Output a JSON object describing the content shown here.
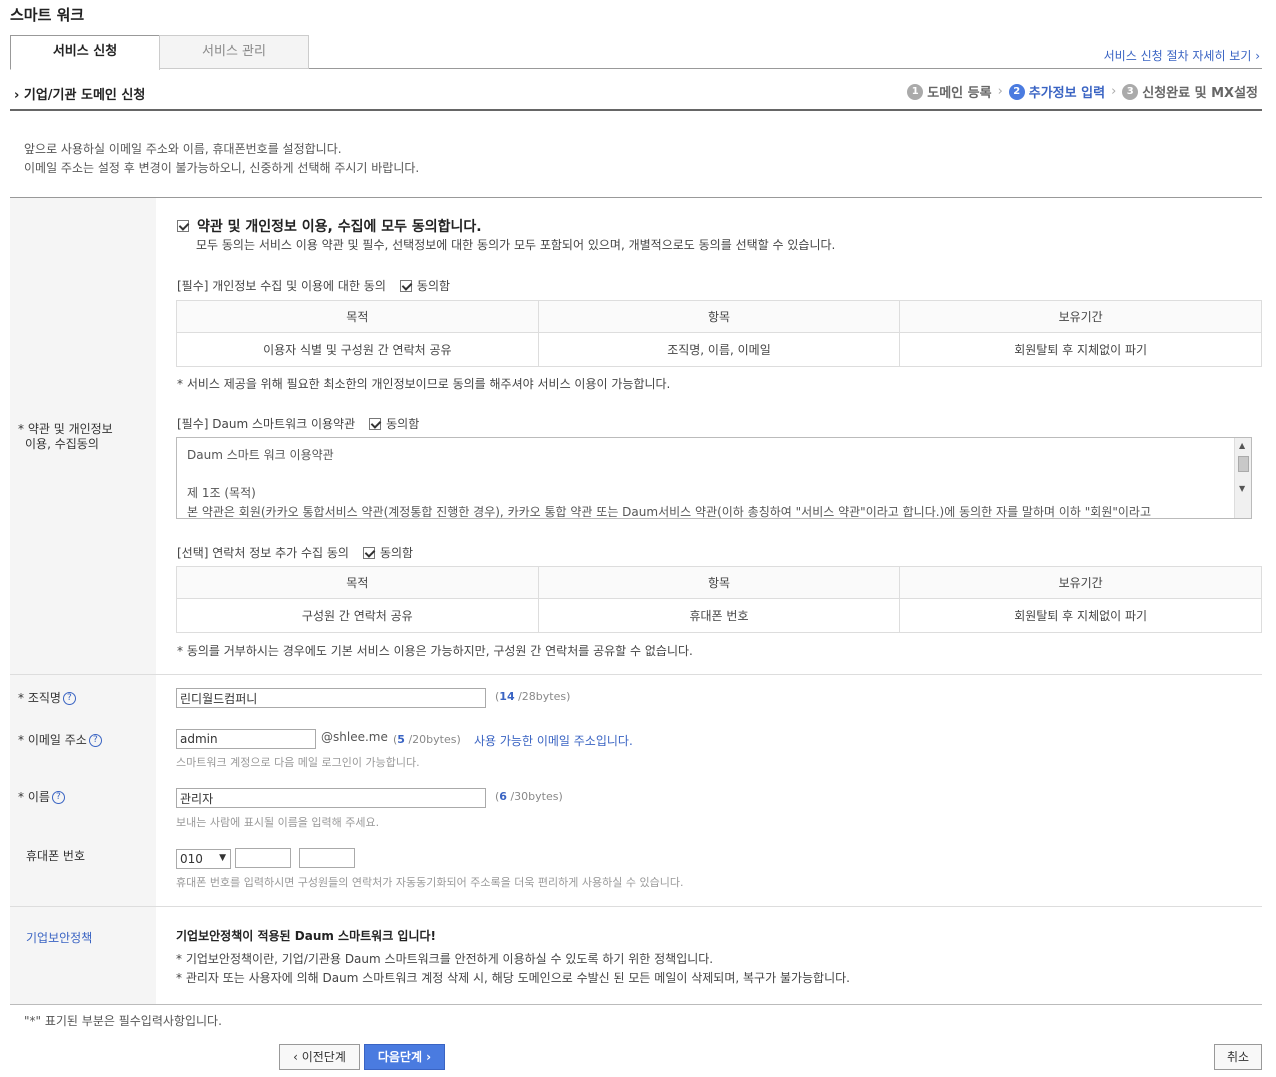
{
  "app": {
    "title": "스마트 워크"
  },
  "tabs": [
    {
      "label": "서비스 신청"
    },
    {
      "label": "서비스 관리"
    }
  ],
  "process_link": "서비스 신청 절차 자세히 보기 ›",
  "section": {
    "title": "기업/기관 도메인 신청",
    "steps": [
      {
        "num": "1",
        "label": "도메인 등록"
      },
      {
        "num": "2",
        "label": "추가정보 입력"
      },
      {
        "num": "3",
        "label": "신청완료 및 MX설정"
      }
    ],
    "step_sep": "›"
  },
  "intro": {
    "line1": "앞으로 사용하실 이메일 주소와 이름, 휴대폰번호를 설정합니다.",
    "line2": "이메일 주소는 설정 후 변경이 불가능하오니, 신중하게 선택해 주시기 바랍니다."
  },
  "agreement": {
    "label_line1": "* 약관 및 개인정보",
    "label_line2": "이용, 수집동의",
    "all_label": "약관 및 개인정보 이용, 수집에 모두 동의합니다.",
    "all_desc": "모두 동의는 서비스 이용 약관 및 필수, 선택정보에 대한 동의가 모두 포함되어 있으며, 개별적으로도 동의를 선택할 수 있습니다.",
    "agree_label": "동의함",
    "privacy": {
      "heading": "[필수] 개인정보 수집 및 이용에 대한 동의",
      "headers": [
        "목적",
        "항목",
        "보유기간"
      ],
      "row": [
        "이용자 식별 및 구성원 간 연락처 공유",
        "조직명, 이름, 이메일",
        "회원탈퇴 후 지체없이 파기"
      ],
      "note": "* 서비스 제공을 위해 필요한 최소한의 개인정보이므로 동의를 해주셔야 서비스 이용이 가능합니다."
    },
    "terms": {
      "heading": "[필수] Daum 스마트워크 이용약관",
      "text_line1": "Daum 스마트 워크 이용약관",
      "text_line2": "",
      "text_line3": "제 1조 (목적)",
      "text_line4": "본 약관은 회원(카카오 통합서비스 약관(계정통합 진행한 경우), 카카오 통합 약관 또는 Daum서비스 약관(이하 총칭하여 \"서비스 약관\"이라고 합니다.)에 동의한 자를 말하며 이하 \"회원\"이라고"
    },
    "contact": {
      "heading": "[선택] 연락처 정보 추가 수집 동의",
      "headers": [
        "목적",
        "항목",
        "보유기간"
      ],
      "row": [
        "구성원 간 연락처 공유",
        "휴대폰 번호",
        "회원탈퇴 후 지체없이 파기"
      ],
      "note": "* 동의를 거부하시는 경우에도 기본 서비스 이용은 가능하지만, 구성원 간 연락처를 공유할 수 없습니다."
    }
  },
  "fields": {
    "org": {
      "label": "* 조직명",
      "value": "린디월드컴퍼니",
      "count": "14",
      "max": " /28bytes)",
      "open": "("
    },
    "email": {
      "label": "* 이메일 주소",
      "value": "admin",
      "suffix": "@shlee.me",
      "count": "5",
      "max": " /20bytes)",
      "open": "(",
      "status": "사용 가능한 이메일 주소입니다.",
      "hint": "스마트워크 계정으로 다음 메일 로그인이 가능합니다."
    },
    "name": {
      "label": "* 이름",
      "value": "관리자",
      "count": "6",
      "max": " /30bytes)",
      "open": "(",
      "hint": "보내는 사람에 표시될 이름을 입력해 주세요."
    },
    "phone": {
      "label": "휴대폰 번호",
      "prefix": "010",
      "mid": "",
      "last": "",
      "hint": "휴대폰 번호를 입력하시면 구성원들의 연락처가 자동동기화되어 주소록을 더욱 편리하게 사용하실 수 있습니다."
    }
  },
  "help_glyph": "?",
  "policy": {
    "label": "기업보안정책",
    "title": "기업보안정책이 적용된 Daum 스마트워크 입니다!",
    "line1": "* 기업보안정책이란, 기업/기관용 Daum 스마트워크를 안전하게 이용하실 수 있도록 하기 위한 정책입니다.",
    "line2": "* 관리자 또는 사용자에 의해 Daum 스마트워크 계정 삭제 시, 해당 도메인으로 수발신 된 모든 메일이 삭제되며, 복구가 불가능합니다."
  },
  "required_note": "\"*\" 표기된 부분은 필수입력사항입니다.",
  "buttons": {
    "prev": "‹ 이전단계",
    "next": "다음단계 ›",
    "cancel": "취소"
  }
}
